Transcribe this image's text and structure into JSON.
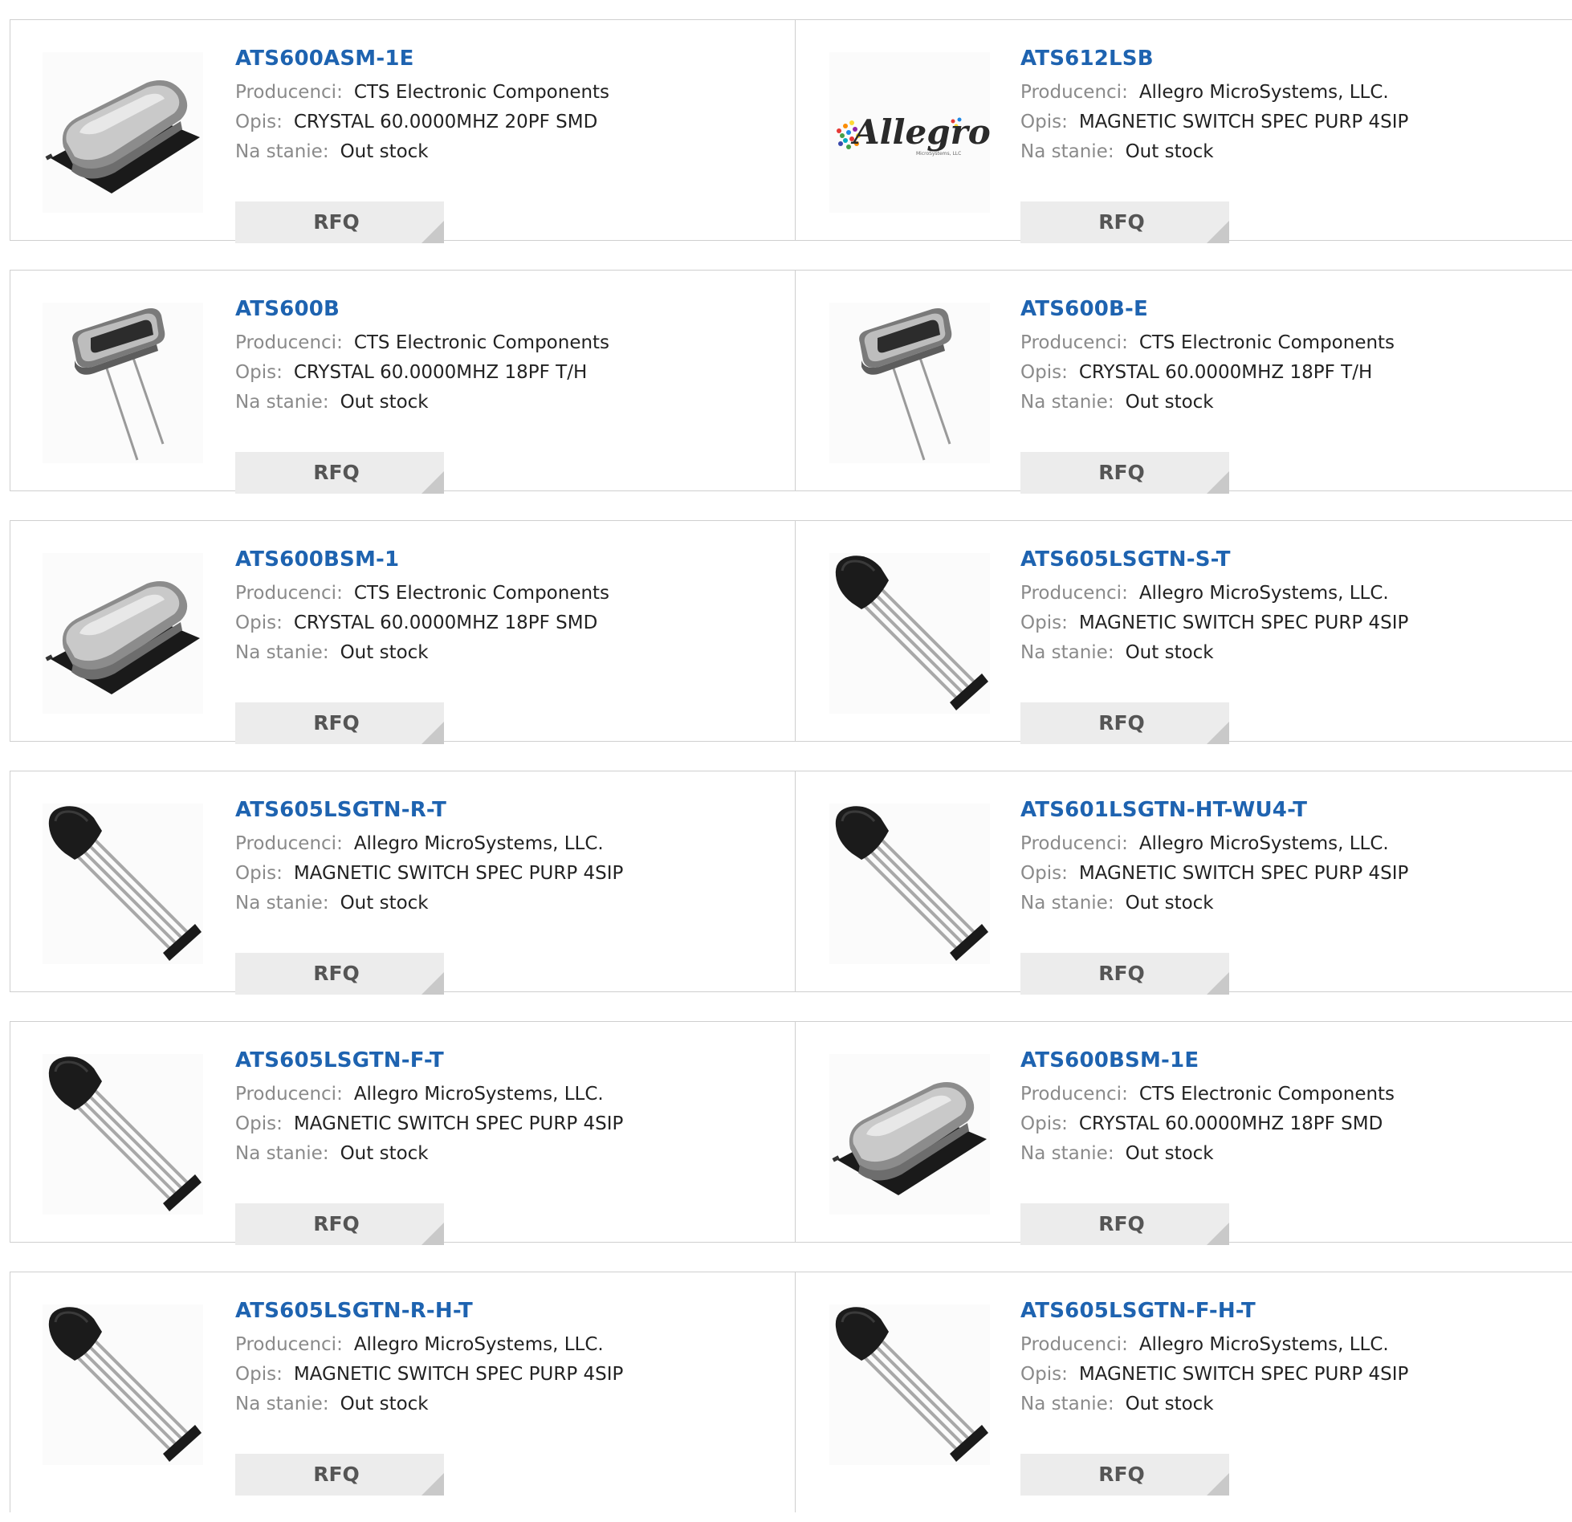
{
  "rfq_label": "RFQ",
  "labels": {
    "manufacturer": "Producenci:",
    "description": "Opis:",
    "stock": "Na stanie:"
  },
  "products": [
    {
      "part": "ATS600ASM-1E",
      "manufacturer": "CTS Electronic Components",
      "description": "CRYSTAL 60.0000MHZ 20PF SMD",
      "stock": "Out stock",
      "image": "crystal-smd-image"
    },
    {
      "part": "ATS612LSB",
      "manufacturer": "Allegro MicroSystems, LLC.",
      "description": "MAGNETIC SWITCH SPEC PURP 4SIP",
      "stock": "Out stock",
      "image": "allegro-logo",
      "logo_text": "Allegro",
      "logo_subtext": "MicroSystems, LLC"
    },
    {
      "part": "ATS600B",
      "manufacturer": "CTS Electronic Components",
      "description": "CRYSTAL 60.0000MHZ 18PF T/H",
      "stock": "Out stock",
      "image": "crystal-th-image"
    },
    {
      "part": "ATS600B-E",
      "manufacturer": "CTS Electronic Components",
      "description": "CRYSTAL 60.0000MHZ 18PF T/H",
      "stock": "Out stock",
      "image": "crystal-th-image"
    },
    {
      "part": "ATS600BSM-1",
      "manufacturer": "CTS Electronic Components",
      "description": "CRYSTAL 60.0000MHZ 18PF SMD",
      "stock": "Out stock",
      "image": "crystal-smd-image"
    },
    {
      "part": "ATS605LSGTN-S-T",
      "manufacturer": "Allegro MicroSystems, LLC.",
      "description": "MAGNETIC SWITCH SPEC PURP 4SIP",
      "stock": "Out stock",
      "image": "sensor-4sip-image"
    },
    {
      "part": "ATS605LSGTN-R-T",
      "manufacturer": "Allegro MicroSystems, LLC.",
      "description": "MAGNETIC SWITCH SPEC PURP 4SIP",
      "stock": "Out stock",
      "image": "sensor-4sip-image"
    },
    {
      "part": "ATS601LSGTN-HT-WU4-T",
      "manufacturer": "Allegro MicroSystems, LLC.",
      "description": "MAGNETIC SWITCH SPEC PURP 4SIP",
      "stock": "Out stock",
      "image": "sensor-4sip-image"
    },
    {
      "part": "ATS605LSGTN-F-T",
      "manufacturer": "Allegro MicroSystems, LLC.",
      "description": "MAGNETIC SWITCH SPEC PURP 4SIP",
      "stock": "Out stock",
      "image": "sensor-4sip-image"
    },
    {
      "part": "ATS600BSM-1E",
      "manufacturer": "CTS Electronic Components",
      "description": "CRYSTAL 60.0000MHZ 18PF SMD",
      "stock": "Out stock",
      "image": "crystal-smd-image"
    },
    {
      "part": "ATS605LSGTN-R-H-T",
      "manufacturer": "Allegro MicroSystems, LLC.",
      "description": "MAGNETIC SWITCH SPEC PURP 4SIP",
      "stock": "Out stock",
      "image": "sensor-4sip-image"
    },
    {
      "part": "ATS605LSGTN-F-H-T",
      "manufacturer": "Allegro MicroSystems, LLC.",
      "description": "MAGNETIC SWITCH SPEC PURP 4SIP",
      "stock": "Out stock",
      "image": "sensor-4sip-image"
    }
  ],
  "colors": {
    "title_link": "#1e63b0",
    "label_gray": "#8a8a8a",
    "value_text": "#222222",
    "border": "#cfcfcf",
    "button_bg": "#ececec",
    "button_text": "#555555"
  }
}
